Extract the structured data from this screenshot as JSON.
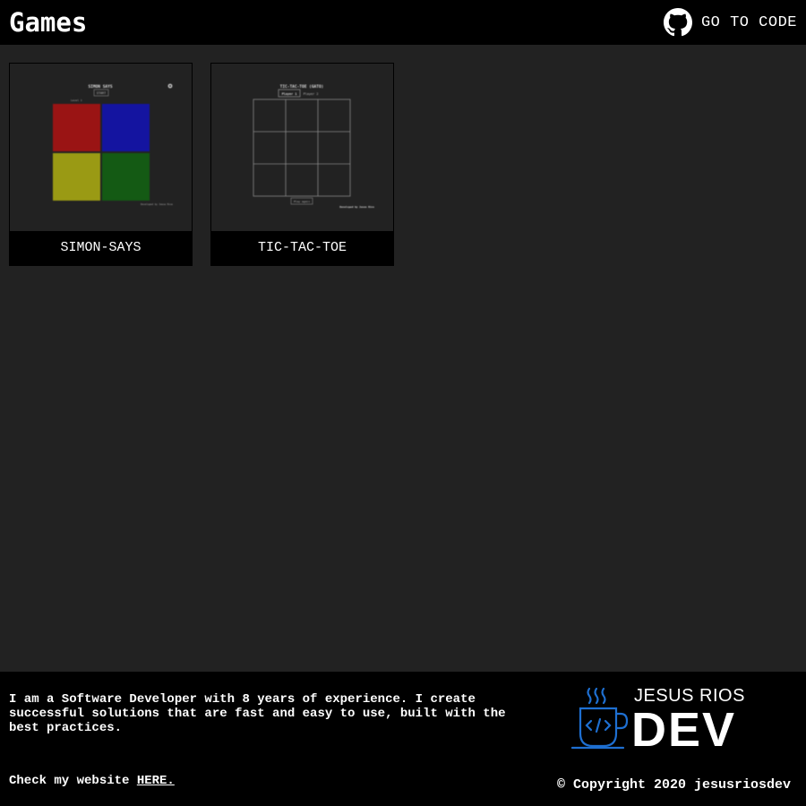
{
  "header": {
    "title": "Games",
    "code_link_label": "GO TO CODE",
    "code_link_icon": "github-icon"
  },
  "games": [
    {
      "label": "SIMON-SAYS",
      "thumbnail": {
        "title": "SIMON SAYS",
        "start_label": "START",
        "level_label": "Level 1",
        "footer_text": "Developed by Jesus Rios",
        "settings_icon": "gear-icon",
        "colors": [
          "#9a1414",
          "#1414a0",
          "#9a9a14",
          "#145a14"
        ]
      }
    },
    {
      "label": "TIC-TAC-TOE",
      "thumbnail": {
        "title": "TIC-TAC-TOE (GATO)",
        "player1_label": "Player 1",
        "player2_label": "Player 2",
        "play_again_label": "Play again",
        "footer_text": "Developed by Jesus Rios"
      }
    }
  ],
  "footer": {
    "bio": "I am a Software Developer with 8 years of experience. I create successful solutions that are fast and easy to use, built with the best practices.",
    "website_prefix": "Check my website ",
    "website_link": "HERE.",
    "logo_top": "JESUS RIOS",
    "logo_bottom": "DEV",
    "copyright": "© Copyright 2020 jesusriosdev",
    "logo_color": "#1e6fd1"
  }
}
